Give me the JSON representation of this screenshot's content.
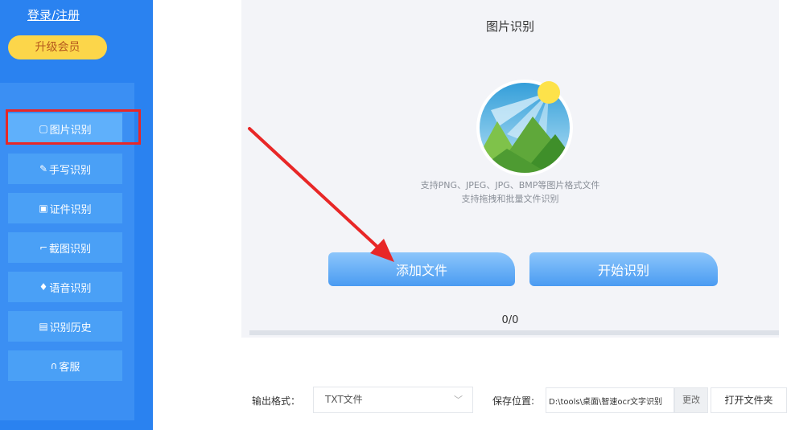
{
  "sidebar": {
    "login_label": "登录/注册",
    "vip_label": "升级会员",
    "items": [
      {
        "icon": "image-icon",
        "glyph": "▢",
        "label": "图片识别"
      },
      {
        "icon": "pen-icon",
        "glyph": "✎",
        "label": "手写识别"
      },
      {
        "icon": "id-card-icon",
        "glyph": "▣",
        "label": "证件识别"
      },
      {
        "icon": "crop-icon",
        "glyph": "⌐",
        "label": "截图识别"
      },
      {
        "icon": "mic-icon",
        "glyph": "♦",
        "label": "语音识别"
      },
      {
        "icon": "history-icon",
        "glyph": "▤",
        "label": "识别历史"
      },
      {
        "icon": "headset-icon",
        "glyph": "∩",
        "label": "客服"
      }
    ],
    "active_index": 0
  },
  "main": {
    "title": "图片识别",
    "hint_line1": "支持PNG、JPEG、JPG、BMP等图片格式文件",
    "hint_line2": "支持拖拽和批量文件识别",
    "add_label": "添加文件",
    "start_label": "开始识别",
    "counter": "0/0",
    "progress": 0
  },
  "bottom": {
    "format_label": "输出格式：",
    "format_value": "TXT文件",
    "save_label": "保存位置:",
    "save_path": "D:\\tools\\桌面\\智速ocr文字识别",
    "change_label": "更改",
    "open_folder_label": "打开文件夹"
  },
  "colors": {
    "sidebar_bg": "#2a82f0",
    "accent": "#4a9bf2",
    "highlight": "#e82727",
    "vip": "#fcd64a"
  }
}
